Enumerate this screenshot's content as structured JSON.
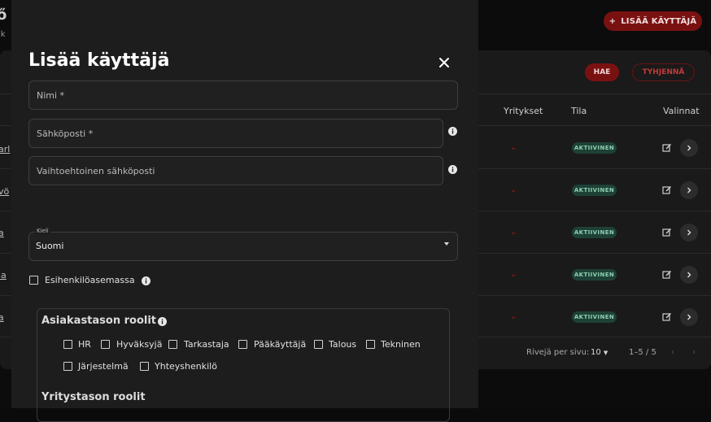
{
  "page": {
    "title_fragment": "ő",
    "subtitle_fragment": "ık",
    "add_user_label": "LISÄÄ KÄYTTÄJÄ"
  },
  "filters": {
    "search_label": "HAE",
    "clear_label": "TYHJENNÄ"
  },
  "table": {
    "columns": [
      "Yritykset",
      "Tila",
      "Valinnat"
    ],
    "left_fragments": [
      "arl",
      "vö",
      "a",
      "la",
      "a"
    ],
    "rows": [
      {
        "status": "AKTIIVINEN"
      },
      {
        "status": "AKTIIVINEN"
      },
      {
        "status": "AKTIIVINEN"
      },
      {
        "status": "AKTIIVINEN"
      },
      {
        "status": "AKTIIVINEN"
      }
    ],
    "pagination": {
      "rows_per_page_label": "Rivejä per sivu:",
      "rows_per_page": "10",
      "range": "1–5 / 5"
    }
  },
  "modal": {
    "title": "Lisää käyttäjä",
    "name_placeholder": "Nimi *",
    "email_placeholder": "Sähköposti *",
    "alt_email_placeholder": "Vaihtoehtoinen sähköposti",
    "language_label": "Kieli",
    "language_value": "Suomi",
    "supervisor_label": "Esihenkilöasemassa",
    "customer_roles_title": "Asiakastason roolit",
    "customer_roles": [
      "HR",
      "Hyväksyjä",
      "Tarkastaja",
      "Pääkäyttäjä",
      "Talous",
      "Tekninen",
      "Järjestelmä",
      "Yhteyshenkilö"
    ],
    "company_roles_title": "Yritystason roolit"
  },
  "colors": {
    "accent": "#7a1111",
    "accent_text": "#c23a3a",
    "status_bg": "#1e4136",
    "status_text": "#8fd0b3"
  },
  "icons": [
    "plus-icon",
    "close-icon",
    "info-icon",
    "edit-icon",
    "chevron-right-icon",
    "chevron-down-icon",
    "caret-down-icon"
  ]
}
